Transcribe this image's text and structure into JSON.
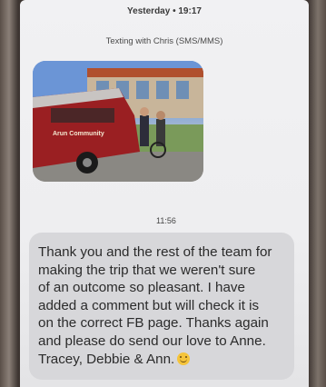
{
  "header": {
    "timestamp": "Yesterday • 19:17",
    "subtitle": "Texting with Chris (SMS/MMS)"
  },
  "photo_message": {
    "image": "minibus-photo",
    "van_text": "Arun Community"
  },
  "text_message": {
    "time": "11:56",
    "lines": [
      "Thank you and the rest of the team for",
      "making the trip that we weren't sure",
      "of an outcome so pleasant.  I have",
      "added a comment but will check it is",
      "on the correct FB page. Thanks again",
      "and please do send our love to Anne.",
      "Tracey, Debbie & Ann."
    ],
    "emoji": "smiling-face-emoji"
  }
}
